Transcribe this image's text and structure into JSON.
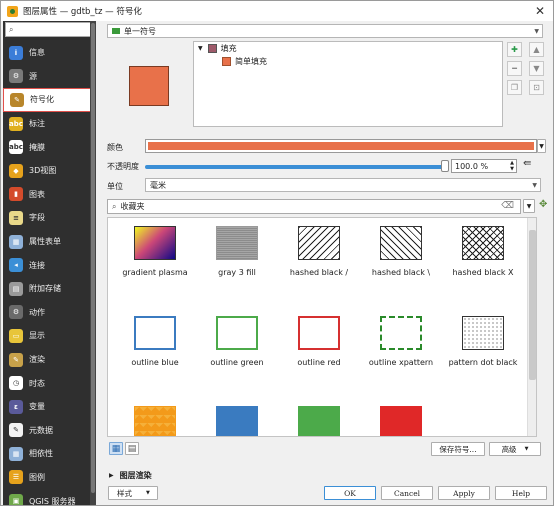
{
  "window": {
    "title": "图层属性 — gdtb_tz — 符号化"
  },
  "sidebar": {
    "search_placeholder": "",
    "items": [
      {
        "label": "信息",
        "icon": "info-icon",
        "color": "#3b7dd8",
        "glyph": "i"
      },
      {
        "label": "源",
        "icon": "source-icon",
        "color": "#7a7a7a",
        "glyph": "⚙"
      },
      {
        "label": "符号化",
        "icon": "paintbrush-icon",
        "color": "#b8862b",
        "glyph": "✎"
      },
      {
        "label": "标注",
        "icon": "label-abc-icon",
        "color": "#e0b020",
        "glyph": "abc"
      },
      {
        "label": "掩膜",
        "icon": "mask-icon",
        "color": "#ffffff",
        "glyph": "abc"
      },
      {
        "label": "3D视图",
        "icon": "cube-3d-icon",
        "color": "#e6a21c",
        "glyph": "◆"
      },
      {
        "label": "图表",
        "icon": "diagram-icon",
        "color": "#d44b2b",
        "glyph": "▮"
      },
      {
        "label": "字段",
        "icon": "fields-icon",
        "color": "#e9d98a",
        "glyph": "≡"
      },
      {
        "label": "属性表单",
        "icon": "form-icon",
        "color": "#8fb1d8",
        "glyph": "▦"
      },
      {
        "label": "连接",
        "icon": "join-icon",
        "color": "#3b8fd6",
        "glyph": "◂"
      },
      {
        "label": "附加存储",
        "icon": "storage-icon",
        "color": "#9a9a9a",
        "glyph": "▤"
      },
      {
        "label": "动作",
        "icon": "action-gear-icon",
        "color": "#6a6a6a",
        "glyph": "⚙"
      },
      {
        "label": "显示",
        "icon": "display-bubble-icon",
        "color": "#e8c53a",
        "glyph": "▭"
      },
      {
        "label": "渲染",
        "icon": "render-brush-icon",
        "color": "#c8a24a",
        "glyph": "✎"
      },
      {
        "label": "时态",
        "icon": "clock-icon",
        "color": "#ffffff",
        "glyph": "◷"
      },
      {
        "label": "变量",
        "icon": "variable-icon",
        "color": "#5a5a9a",
        "glyph": "ε"
      },
      {
        "label": "元数据",
        "icon": "metadata-icon",
        "color": "#f2f2f2",
        "glyph": "✎"
      },
      {
        "label": "相依性",
        "icon": "dependency-icon",
        "color": "#8fb1d8",
        "glyph": "▦"
      },
      {
        "label": "图例",
        "icon": "legend-icon",
        "color": "#e6a21c",
        "glyph": "☰"
      },
      {
        "label": "QGIS 服务器",
        "icon": "server-icon",
        "color": "#6fa84a",
        "glyph": "▣"
      }
    ]
  },
  "symbol_type": "单一符号",
  "layer_tree": {
    "root": "填充",
    "child": "简单填充"
  },
  "color_label": "颜色",
  "opacity_label": "不透明度",
  "opacity_value": "100.0 %",
  "opacity_level": 1.0,
  "unit_label": "单位",
  "unit_value": "毫米",
  "library_filter": "收藏夹",
  "symbols": [
    {
      "name": "gradient  plasma",
      "kind": "gradient"
    },
    {
      "name": "gray 3 fill",
      "kind": "gray"
    },
    {
      "name": "hashed black /",
      "kind": "hash-fwd"
    },
    {
      "name": "hashed black \\",
      "kind": "hash-back"
    },
    {
      "name": "hashed black X",
      "kind": "hash-x"
    },
    {
      "name": "outline blue",
      "kind": "outline",
      "color": "#3b7bc0"
    },
    {
      "name": "outline green",
      "kind": "outline",
      "color": "#4caa4a"
    },
    {
      "name": "outline red",
      "kind": "outline",
      "color": "#d63030"
    },
    {
      "name": "outline xpattern",
      "kind": "xpattern"
    },
    {
      "name": "pattern dot black",
      "kind": "dots"
    },
    {
      "name": "",
      "kind": "triangles"
    },
    {
      "name": "",
      "kind": "solid",
      "color": "#3a7bc0"
    },
    {
      "name": "",
      "kind": "solid",
      "color": "#4caa4a"
    },
    {
      "name": "",
      "kind": "solid",
      "color": "#e02828"
    }
  ],
  "buttons": {
    "save_symbol": "保存符号...",
    "advanced": "高级",
    "ok": "OK",
    "cancel": "Cancel",
    "apply": "Apply",
    "help": "Help",
    "style": "样式"
  },
  "layer_render": "图层渲染",
  "accent_color": "#e8714a"
}
